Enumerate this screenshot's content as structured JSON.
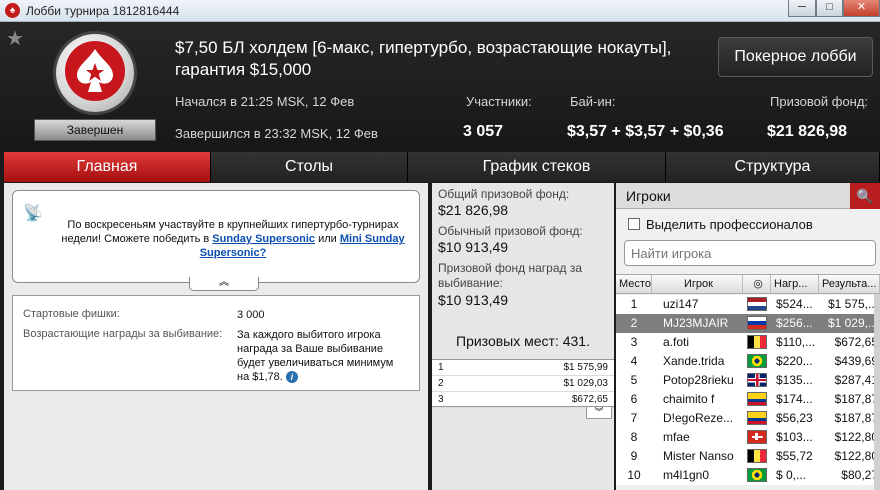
{
  "window": {
    "title": "Лобби турнира 1812816444",
    "min": "─",
    "max": "□",
    "close": "✕"
  },
  "header": {
    "tournament_name": "$7,50 БЛ холдем [6-макс, гипертурбо, возрастающие нокауты], гарантия $15,000",
    "status": "Завершен",
    "started": "Начался в 21:25 MSK, 12 Фев",
    "finished": "Завершился в 23:32 MSK, 12 Фев",
    "participants_label": "Участники:",
    "participants_value": "3 057",
    "buyin_label": "Бай-ин:",
    "buyin_value": "$3,57 + $3,57 + $0,36",
    "prizepool_label": "Призовой фонд:",
    "prizepool_value": "$21 826,98",
    "lobby_button": "Покерное лобби",
    "star_icon": "★"
  },
  "tabs": [
    "Главная",
    "Столы",
    "График стеков",
    "Структура"
  ],
  "notice": {
    "text_before": "По воскресеньям участвуйте в крупнейших гипертурбо-турнирах недели! Сможете победить в",
    "link1": "Sunday Supersonic",
    "between": "или",
    "link2": "Mini Sunday Supersonic?",
    "collapse": "︽",
    "icon": "📡"
  },
  "info": {
    "chips_label": "Стартовые фишки:",
    "chips_value": "3 000",
    "bounty_label": "Возрастающие награды за выбивание:",
    "bounty_value": "За каждого выбитого игрока награда за Ваше выбивание будет увеличиваться минимум на $1,78.",
    "info_icon": "i"
  },
  "prize": {
    "total_label": "Общий призовой фонд:",
    "total_value": "$21 826,98",
    "regular_label": "Обычный призовой фонд:",
    "regular_value": "$10 913,49",
    "bounty_label": "Призовой фонд наград за выбивание:",
    "bounty_value": "$10 913,49",
    "places": "Призовых мест: 431.",
    "rows": [
      {
        "place": "1",
        "value": "$1 575,99"
      },
      {
        "place": "2",
        "value": "$1 029,03"
      },
      {
        "place": "3",
        "value": "$672,65"
      }
    ],
    "more": "︾"
  },
  "players": {
    "title": "Игроки",
    "search_icon": "🔍",
    "pro_label": "Выделить профессионалов",
    "search_placeholder": "Найти игрока",
    "columns": {
      "place": "Место",
      "player": "Игрок",
      "country": "◎",
      "bounty": "Нагр...",
      "result": "Результа..."
    },
    "rows": [
      {
        "place": "1",
        "name": "uzi147",
        "flag": "nl",
        "bounty": "$524...",
        "result": "$1 575,..."
      },
      {
        "place": "2",
        "name": "MJ23MJAIR",
        "flag": "ru",
        "bounty": "$256...",
        "result": "$1 029,..."
      },
      {
        "place": "3",
        "name": "a.foti",
        "flag": "be",
        "bounty": "$110,...",
        "result": "$672,65"
      },
      {
        "place": "4",
        "name": "Xande.trida",
        "flag": "br",
        "bounty": "$220...",
        "result": "$439,69"
      },
      {
        "place": "5",
        "name": "Potop28rieku",
        "flag": "gb",
        "bounty": "$135...",
        "result": "$287,41"
      },
      {
        "place": "6",
        "name": "chaimito f",
        "flag": "co",
        "bounty": "$174...",
        "result": "$187,87"
      },
      {
        "place": "7",
        "name": "D!egoReze...",
        "flag": "co",
        "bounty": "$56,23",
        "result": "$187,87"
      },
      {
        "place": "8",
        "name": "mfae",
        "flag": "ch",
        "bounty": "$103...",
        "result": "$122,80"
      },
      {
        "place": "9",
        "name": "Mister Nanso",
        "flag": "be",
        "bounty": "$55,72",
        "result": "$122,80"
      },
      {
        "place": "10",
        "name": "m4l1gn0",
        "flag": "br",
        "bounty": "$ 0,...",
        "result": "$80,27"
      }
    ]
  }
}
